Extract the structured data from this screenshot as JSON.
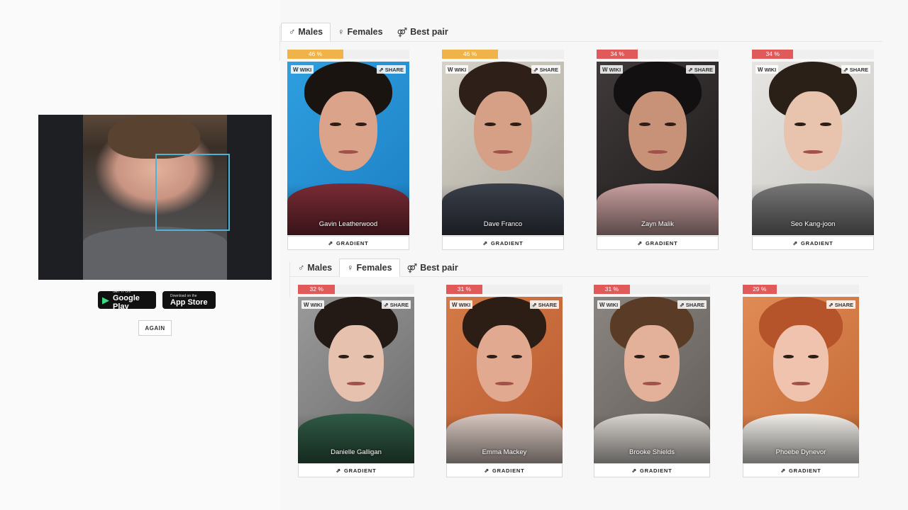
{
  "left": {
    "google_play": {
      "small": "GET IT ON",
      "big": "Google Play"
    },
    "app_store": {
      "small": "Download on the",
      "big": "App Store"
    },
    "again_label": "AGAIN"
  },
  "male_section": {
    "tabs": [
      {
        "symbol": "♂",
        "label": "Males"
      },
      {
        "symbol": "♀",
        "label": "Females"
      },
      {
        "symbol": "⚤",
        "label": "Best pair"
      }
    ],
    "active_tab": "Males",
    "cards": [
      {
        "name": "Gavin Leatherwood",
        "percent": "46 %",
        "percent_value": 0.46,
        "bar_color": "#f0b34a",
        "wiki": "WIKI",
        "share": "SHARE",
        "gradient": "GRADIENT"
      },
      {
        "name": "Dave Franco",
        "percent": "46 %",
        "percent_value": 0.46,
        "bar_color": "#f0b34a",
        "wiki": "WIKI",
        "share": "SHARE",
        "gradient": "GRADIENT"
      },
      {
        "name": "Zayn Malik",
        "percent": "34 %",
        "percent_value": 0.34,
        "bar_color": "#e05a5a",
        "wiki": "WIKI",
        "share": "SHARE",
        "gradient": "GRADIENT"
      },
      {
        "name": "Seo Kang-joon",
        "percent": "34 %",
        "percent_value": 0.34,
        "bar_color": "#e05a5a",
        "wiki": "WIKI",
        "share": "SHARE",
        "gradient": "GRADIENT"
      }
    ]
  },
  "female_section": {
    "tabs": [
      {
        "symbol": "♂",
        "label": "Males"
      },
      {
        "symbol": "♀",
        "label": "Females"
      },
      {
        "symbol": "⚤",
        "label": "Best pair"
      }
    ],
    "active_tab": "Females",
    "cards": [
      {
        "name": "Danielle Galligan",
        "percent": "32 %",
        "percent_value": 0.32,
        "bar_color": "#e05a5a",
        "wiki": "WIKI",
        "share": "SHARE",
        "gradient": "GRADIENT"
      },
      {
        "name": "Emma Mackey",
        "percent": "31 %",
        "percent_value": 0.31,
        "bar_color": "#e05a5a",
        "wiki": "WIKI",
        "share": "SHARE",
        "gradient": "GRADIENT"
      },
      {
        "name": "Brooke Shields",
        "percent": "31 %",
        "percent_value": 0.31,
        "bar_color": "#e05a5a",
        "wiki": "WIKI",
        "share": "SHARE",
        "gradient": "GRADIENT"
      },
      {
        "name": "Phoebe Dynevor",
        "percent": "29 %",
        "percent_value": 0.29,
        "bar_color": "#e05a5a",
        "wiki": "",
        "share": "SHARE",
        "gradient": "GRADIENT"
      }
    ]
  }
}
